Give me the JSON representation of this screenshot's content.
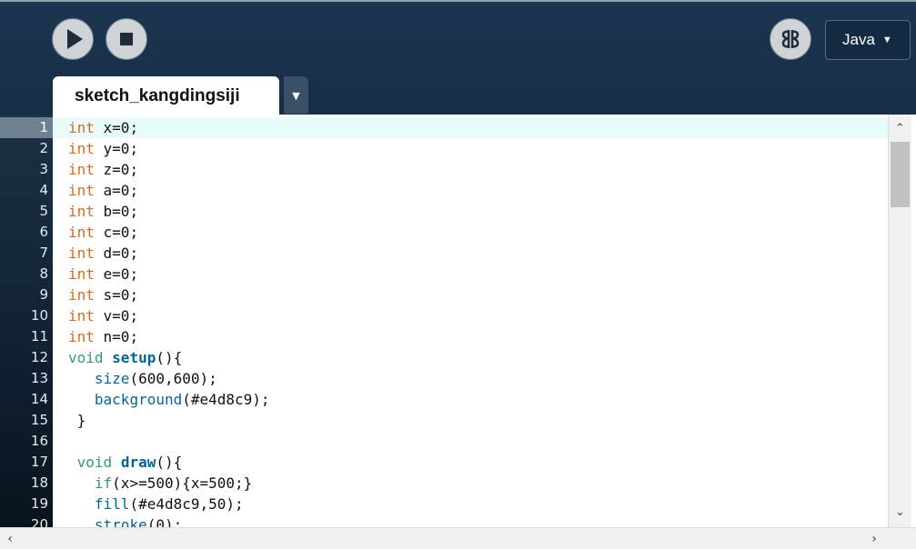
{
  "toolbar": {
    "run_icon": "play-icon",
    "stop_icon": "stop-icon",
    "mode_icon": "butterfly-icon",
    "mode_selector": {
      "label": "Java",
      "caret": "▼"
    }
  },
  "tabs": [
    {
      "label": "sketch_kangdingsiji",
      "active": true
    }
  ],
  "tab_menu": {
    "caret": "▼"
  },
  "editor": {
    "active_line": 1,
    "lines": [
      {
        "n": "1",
        "tokens": [
          {
            "t": "int",
            "c": "kw"
          },
          {
            "t": " x=0;"
          }
        ]
      },
      {
        "n": "2",
        "tokens": [
          {
            "t": "int",
            "c": "kw"
          },
          {
            "t": " y=0;"
          }
        ]
      },
      {
        "n": "3",
        "tokens": [
          {
            "t": "int",
            "c": "kw"
          },
          {
            "t": " z=0;"
          }
        ]
      },
      {
        "n": "4",
        "tokens": [
          {
            "t": "int",
            "c": "kw"
          },
          {
            "t": " a=0;"
          }
        ]
      },
      {
        "n": "5",
        "tokens": [
          {
            "t": "int",
            "c": "kw"
          },
          {
            "t": " b=0;"
          }
        ]
      },
      {
        "n": "6",
        "tokens": [
          {
            "t": "int",
            "c": "kw"
          },
          {
            "t": " c=0;"
          }
        ]
      },
      {
        "n": "7",
        "tokens": [
          {
            "t": "int",
            "c": "kw"
          },
          {
            "t": " d=0;"
          }
        ]
      },
      {
        "n": "8",
        "tokens": [
          {
            "t": "int",
            "c": "kw"
          },
          {
            "t": " e=0;"
          }
        ]
      },
      {
        "n": "9",
        "tokens": [
          {
            "t": "int",
            "c": "kw"
          },
          {
            "t": " s=0;"
          }
        ]
      },
      {
        "n": "10",
        "tokens": [
          {
            "t": "int",
            "c": "kw"
          },
          {
            "t": " v=0;"
          }
        ]
      },
      {
        "n": "11",
        "tokens": [
          {
            "t": "int",
            "c": "kw"
          },
          {
            "t": " n=0;"
          }
        ]
      },
      {
        "n": "12",
        "tokens": [
          {
            "t": "void",
            "c": "kw-void"
          },
          {
            "t": " "
          },
          {
            "t": "setup",
            "c": "fn"
          },
          {
            "t": "(){"
          }
        ]
      },
      {
        "n": "13",
        "tokens": [
          {
            "t": "   "
          },
          {
            "t": "size",
            "c": "bi"
          },
          {
            "t": "(600,600);"
          }
        ]
      },
      {
        "n": "14",
        "tokens": [
          {
            "t": "   "
          },
          {
            "t": "background",
            "c": "bi"
          },
          {
            "t": "(#e4d8c9);"
          }
        ]
      },
      {
        "n": "15",
        "tokens": [
          {
            "t": " }"
          }
        ]
      },
      {
        "n": "16",
        "tokens": []
      },
      {
        "n": "17",
        "tokens": [
          {
            "t": " "
          },
          {
            "t": "void",
            "c": "kw-void"
          },
          {
            "t": " "
          },
          {
            "t": "draw",
            "c": "fn"
          },
          {
            "t": "(){"
          }
        ]
      },
      {
        "n": "18",
        "tokens": [
          {
            "t": "   "
          },
          {
            "t": "if",
            "c": "kw-void"
          },
          {
            "t": "(x>=500){x=500;}"
          }
        ]
      },
      {
        "n": "19",
        "tokens": [
          {
            "t": "   "
          },
          {
            "t": "fill",
            "c": "bi"
          },
          {
            "t": "(#e4d8c9,50);"
          }
        ]
      },
      {
        "n": "20",
        "tokens": [
          {
            "t": "   "
          },
          {
            "t": "stroke",
            "c": "bi"
          },
          {
            "t": "(0);"
          }
        ]
      }
    ]
  },
  "scrollbars": {
    "vertical": {
      "up": "⌃",
      "down": "⌄"
    },
    "horizontal": {
      "left": "‹",
      "right": "›"
    }
  }
}
